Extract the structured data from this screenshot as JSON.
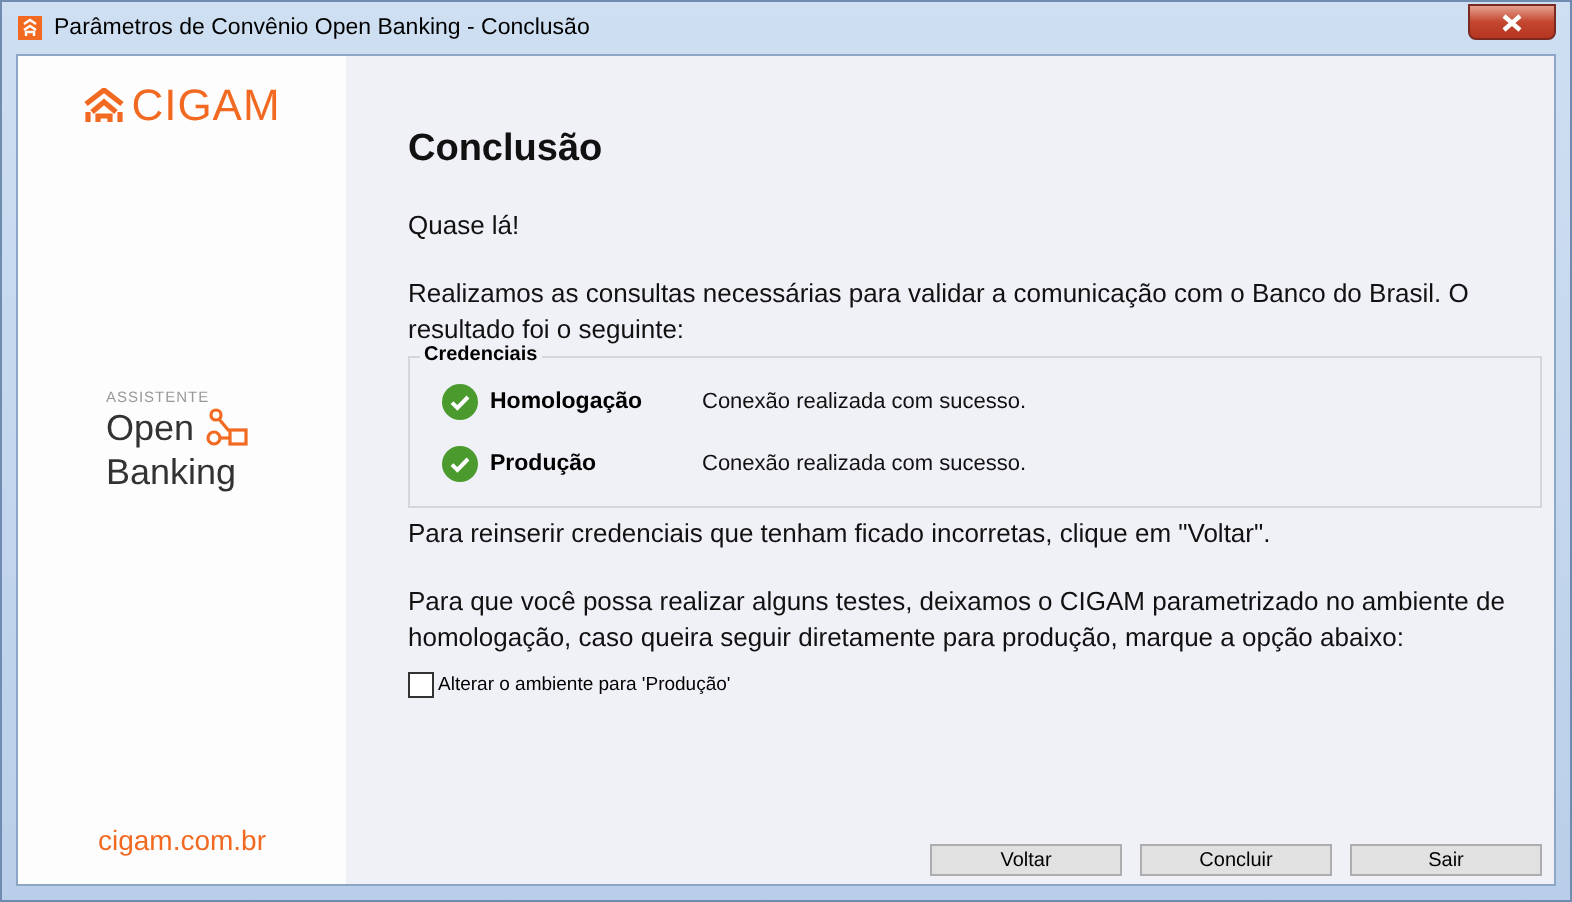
{
  "window": {
    "title": "Parâmetros de Convênio Open Banking - Conclusão"
  },
  "sidebar": {
    "logo_text": "CIGAM",
    "assistant_label": "ASSISTENTE",
    "product_lines": [
      "Open",
      "Banking"
    ],
    "website": "cigam.com.br"
  },
  "heading": "Conclusão",
  "intro": "Quase lá!",
  "description": "Realizamos as consultas necessárias para validar a comunicação com o Banco do Brasil. O resultado foi o seguinte:",
  "credentials": {
    "title": "Credenciais",
    "rows": [
      {
        "name": "Homologação",
        "kind": "success",
        "message": "Conexão realizada com sucesso."
      },
      {
        "name": "Produção",
        "kind": "success",
        "message": "Conexão realizada com sucesso."
      }
    ]
  },
  "retry_note": "Para reinserir credenciais que tenham ficado incorretas, clique em \"Voltar\".",
  "environment_note": "Para que você possa realizar alguns testes, deixamos o CIGAM parametrizado no ambiente de homologação, caso queira seguir diretamente para produção, marque a opção abaixo:",
  "checkbox": {
    "label": "Alterar o ambiente para 'Produção'",
    "checked": false
  },
  "buttons": [
    "Voltar",
    "Concluir",
    "Sair"
  ]
}
